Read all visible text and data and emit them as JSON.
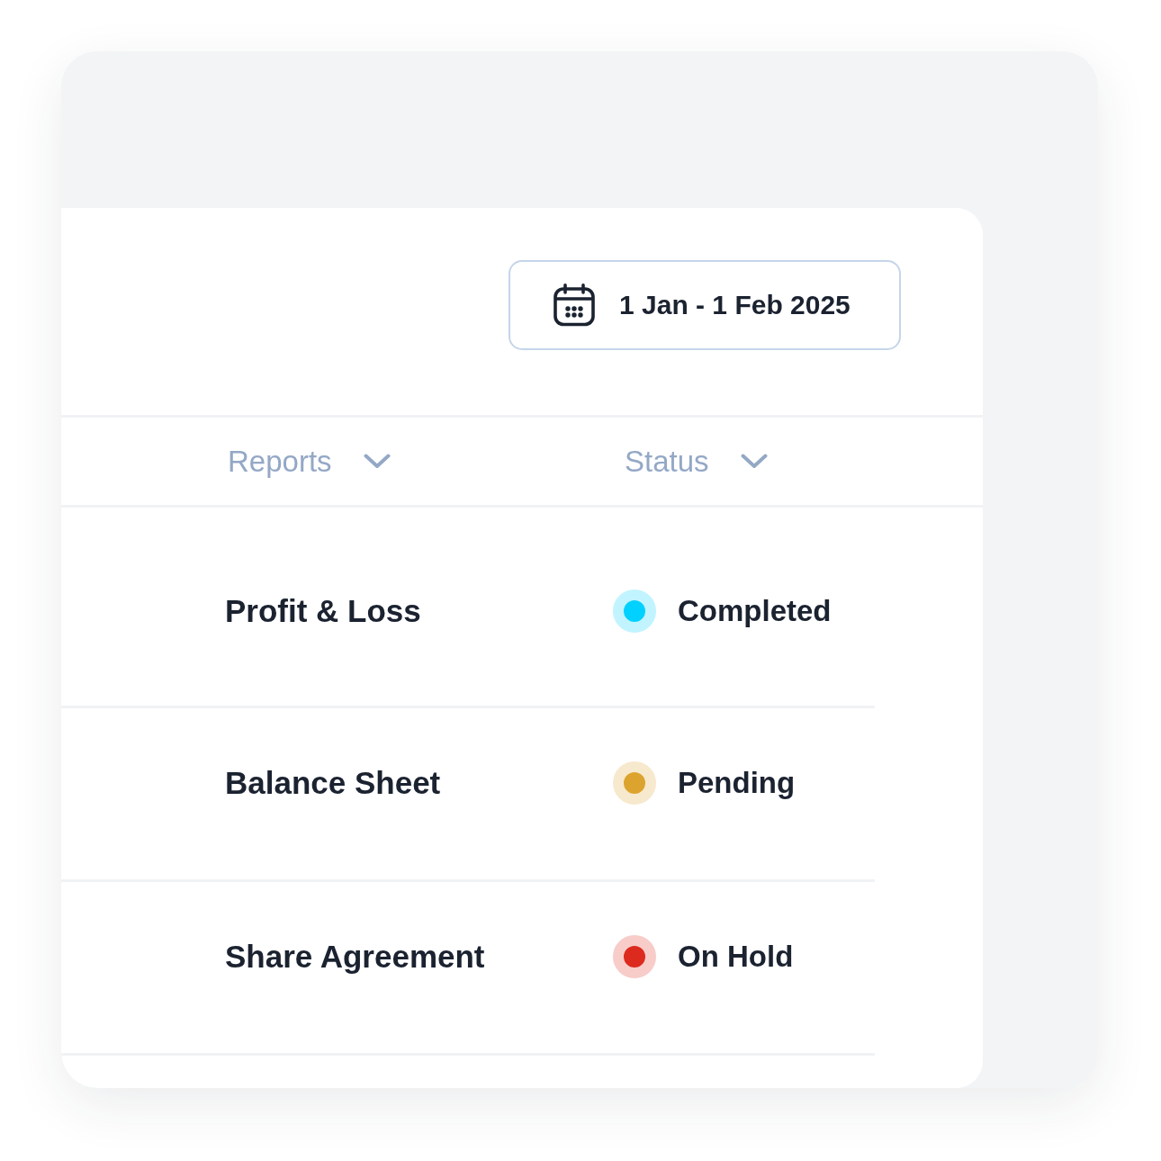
{
  "date_range": {
    "label": "1 Jan - 1 Feb 2025"
  },
  "table": {
    "columns": [
      {
        "label": "Reports"
      },
      {
        "label": "Status"
      }
    ],
    "rows": [
      {
        "report": "Profit & Loss",
        "status": "Completed",
        "color": "#00d1ff"
      },
      {
        "report": "Balance Sheet",
        "status": "Pending",
        "color": "#dca42e"
      },
      {
        "report": "Share Agreement",
        "status": "On Hold",
        "color": "#dc2a1e"
      }
    ]
  }
}
